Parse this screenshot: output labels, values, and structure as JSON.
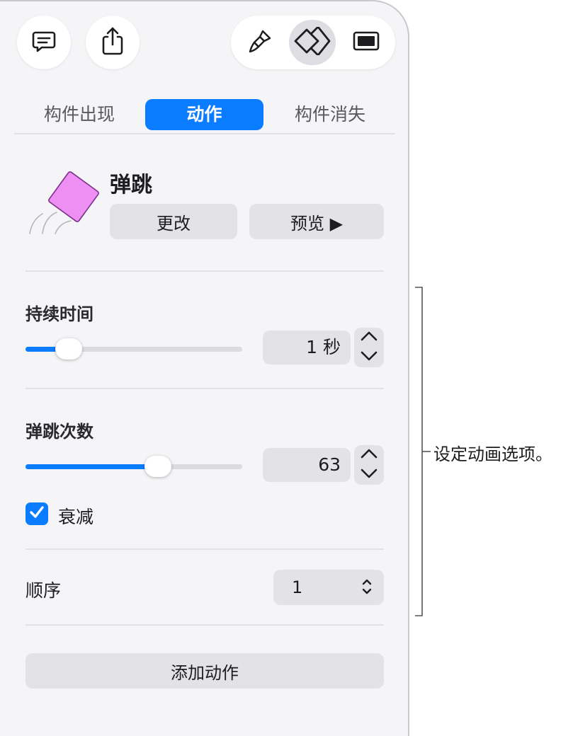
{
  "toolbar": {
    "comment_icon": "comment-icon",
    "share_icon": "share-icon",
    "format_icon": "paintbrush-icon",
    "animate_icon": "animate-icon",
    "document_icon": "document-icon"
  },
  "tabs": [
    {
      "label": "构件出现",
      "active": false
    },
    {
      "label": "动作",
      "active": true
    },
    {
      "label": "构件消失",
      "active": false
    }
  ],
  "effect": {
    "name": "弹跳",
    "change_label": "更改",
    "preview_label": "预览 ▶"
  },
  "duration": {
    "label": "持续时间",
    "value": "1 秒",
    "slider_fraction": 0.2
  },
  "bounce_count": {
    "label": "弹跳次数",
    "value": "63",
    "slider_fraction": 0.61
  },
  "decay": {
    "label": "衰减",
    "checked": true
  },
  "order": {
    "label": "顺序",
    "value": "1"
  },
  "add_action_label": "添加动作",
  "annotation": "设定动画选项。",
  "colors": {
    "accent": "#0a7cff",
    "shape": "#ee90f3"
  }
}
